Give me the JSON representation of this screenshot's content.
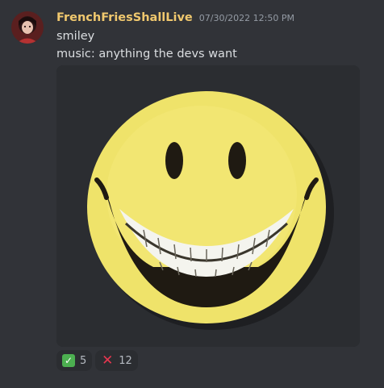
{
  "message": {
    "username": "FrenchFriesShallLive",
    "timestamp": "07/30/2022 12:50 PM",
    "lines": [
      "smiley",
      "music: anything the devs want"
    ]
  },
  "attachment": {
    "icon": "smiley-face-image"
  },
  "reactions": [
    {
      "emoji": "white-check-mark",
      "glyph": "✓",
      "count": "5"
    },
    {
      "emoji": "cross-mark",
      "glyph": "✕",
      "count": "12"
    }
  ],
  "colors": {
    "background": "#313338",
    "username": "#f0c86e",
    "timestamp": "#949ba4",
    "text": "#dbdee1",
    "reaction_bg": "#2b2d31",
    "check_green": "#4caf50",
    "cross_red": "#e5364f"
  }
}
